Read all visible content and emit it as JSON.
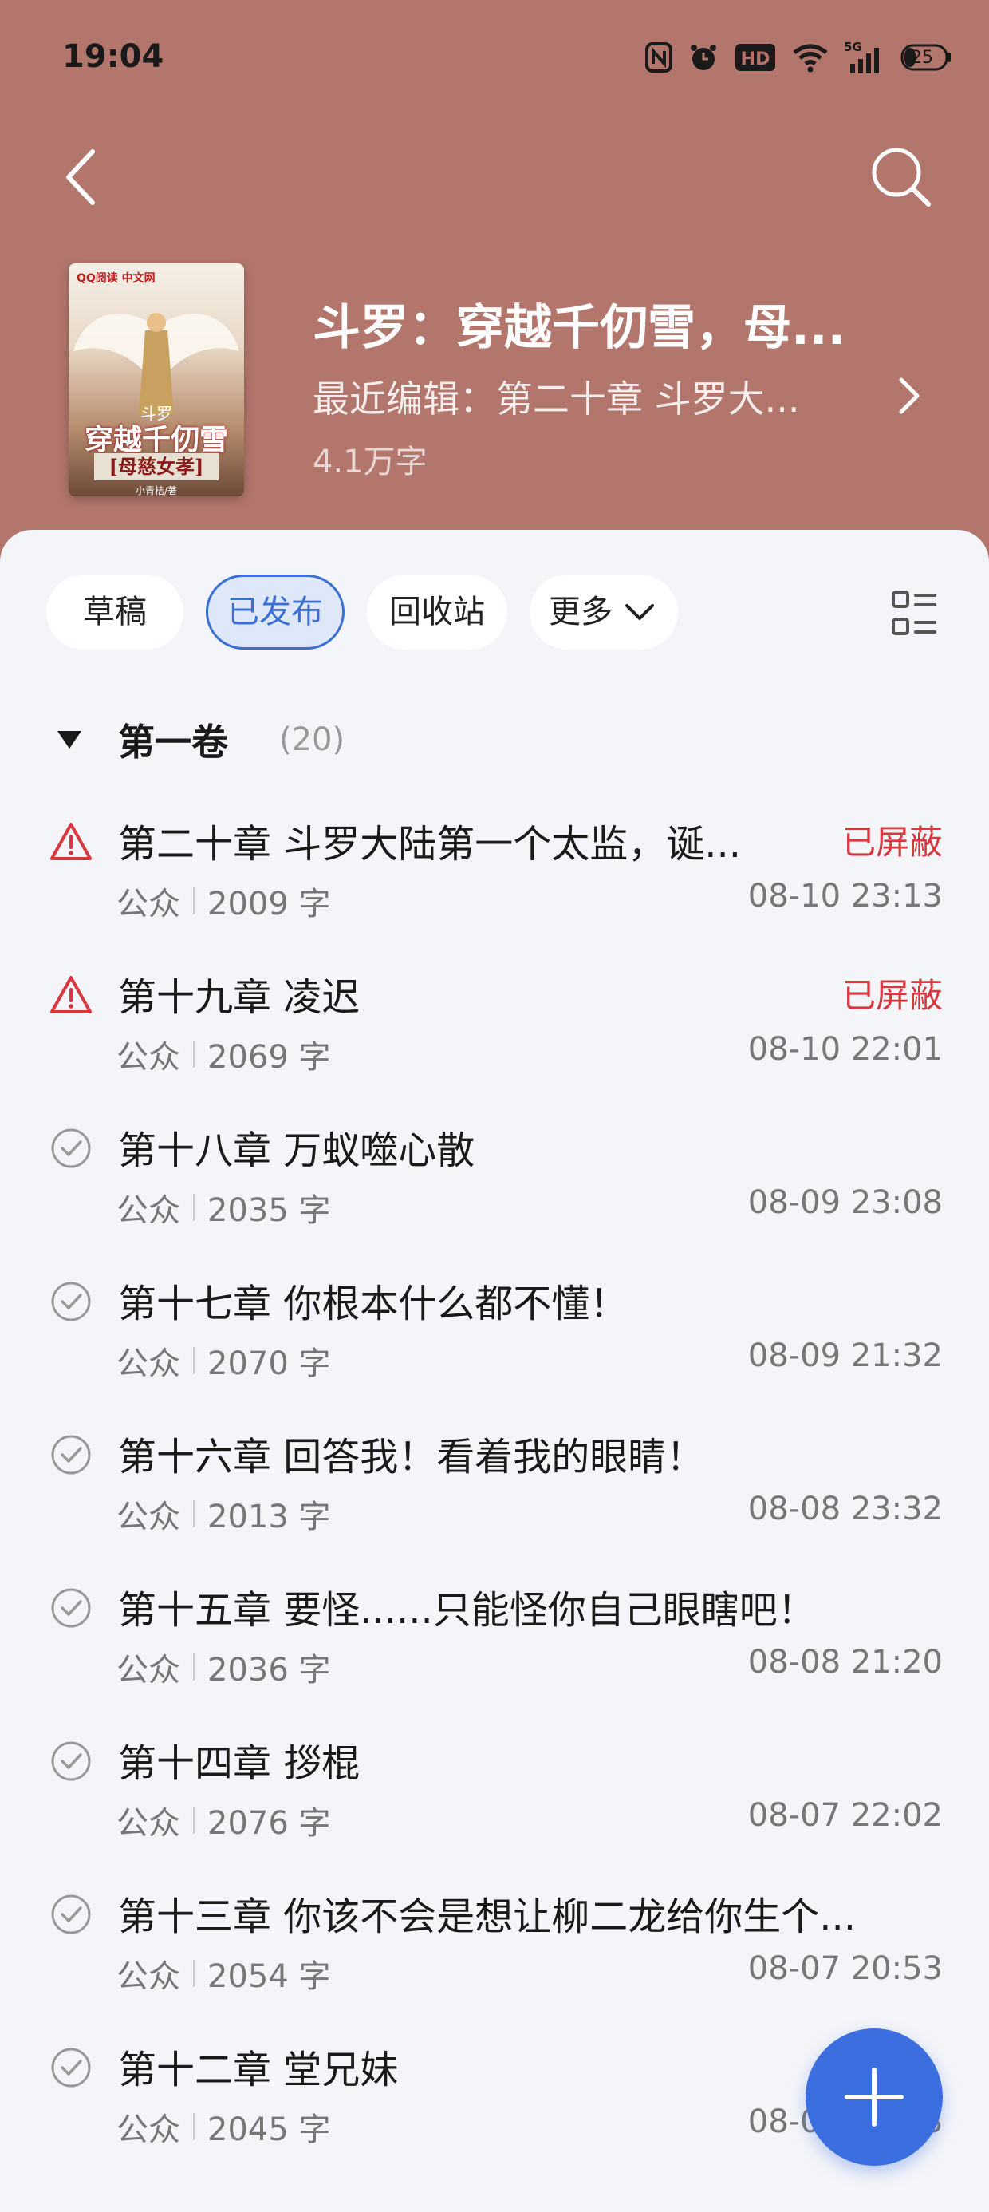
{
  "status_bar": {
    "time": "19:04",
    "battery": "25",
    "network": "5G"
  },
  "book": {
    "title": "斗罗：穿越千仞雪，母...",
    "last_edit": "最近编辑：第二十章 斗罗大...",
    "word_count": "4.1万字",
    "cover": {
      "logo": "QQ阅读 中文网",
      "small_title": "斗罗",
      "title": "穿越千仞雪",
      "subtitle": "[母慈女孝]",
      "author": "小青桔/著"
    }
  },
  "tabs": [
    {
      "label": "草稿"
    },
    {
      "label": "已发布",
      "active": true
    },
    {
      "label": "回收站"
    },
    {
      "label": "更多"
    }
  ],
  "volume": {
    "name": "第一卷",
    "count": "(20)"
  },
  "chapters": [
    {
      "title": "第二十章 斗罗大陆第一个太监，诞...",
      "status": "已屏蔽",
      "source": "公众",
      "words": "2009 字",
      "time": "08-10 23:13",
      "icon": "warning-icon"
    },
    {
      "title": "第十九章 凌迟",
      "status": "已屏蔽",
      "source": "公众",
      "words": "2069 字",
      "time": "08-10 22:01",
      "icon": "warning-icon"
    },
    {
      "title": "第十八章 万蚁噬心散",
      "status": "",
      "source": "公众",
      "words": "2035 字",
      "time": "08-09 23:08",
      "icon": "check-icon"
    },
    {
      "title": "第十七章 你根本什么都不懂！",
      "status": "",
      "source": "公众",
      "words": "2070 字",
      "time": "08-09 21:32",
      "icon": "check-icon"
    },
    {
      "title": "第十六章 回答我！看着我的眼睛！",
      "status": "",
      "source": "公众",
      "words": "2013 字",
      "time": "08-08 23:32",
      "icon": "check-icon"
    },
    {
      "title": "第十五章 要怪......只能怪你自己眼瞎吧！",
      "status": "",
      "source": "公众",
      "words": "2036 字",
      "time": "08-08 21:20",
      "icon": "check-icon"
    },
    {
      "title": "第十四章 拶棍",
      "status": "",
      "source": "公众",
      "words": "2076 字",
      "time": "08-07 22:02",
      "icon": "check-icon"
    },
    {
      "title": "第十三章 你该不会是想让柳二龙给你生个...",
      "status": "",
      "source": "公众",
      "words": "2054 字",
      "time": "08-07 20:53",
      "icon": "check-icon"
    },
    {
      "title": "第十二章 堂兄妹",
      "status": "",
      "source": "公众",
      "words": "2045 字",
      "time": "08-07 20:18",
      "icon": "check-icon"
    }
  ],
  "colors": {
    "header_bg": "#b2766c",
    "accent": "#3b6fe0",
    "blocked": "#d8373d"
  }
}
